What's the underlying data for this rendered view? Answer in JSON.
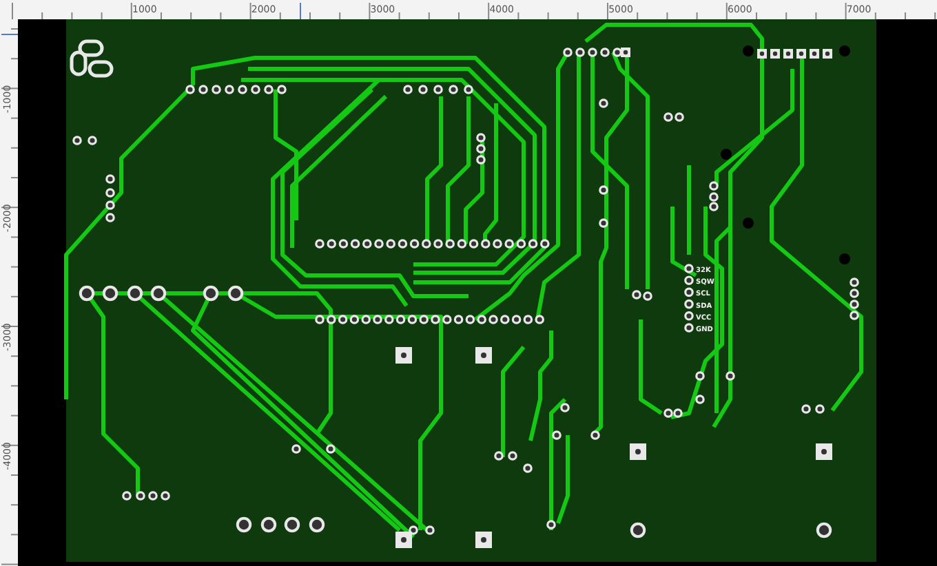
{
  "ruler_top": {
    "labels": [
      "1000",
      "2000",
      "3000",
      "4000",
      "5000",
      "6000",
      "7000"
    ]
  },
  "ruler_left": {
    "labels": [
      "-1000",
      "-2000",
      "-3000",
      "-4000"
    ]
  },
  "board": {
    "silkscreen_labels": [
      "32K",
      "SQW",
      "SCL",
      "SDA",
      "VCC",
      "GND"
    ]
  }
}
